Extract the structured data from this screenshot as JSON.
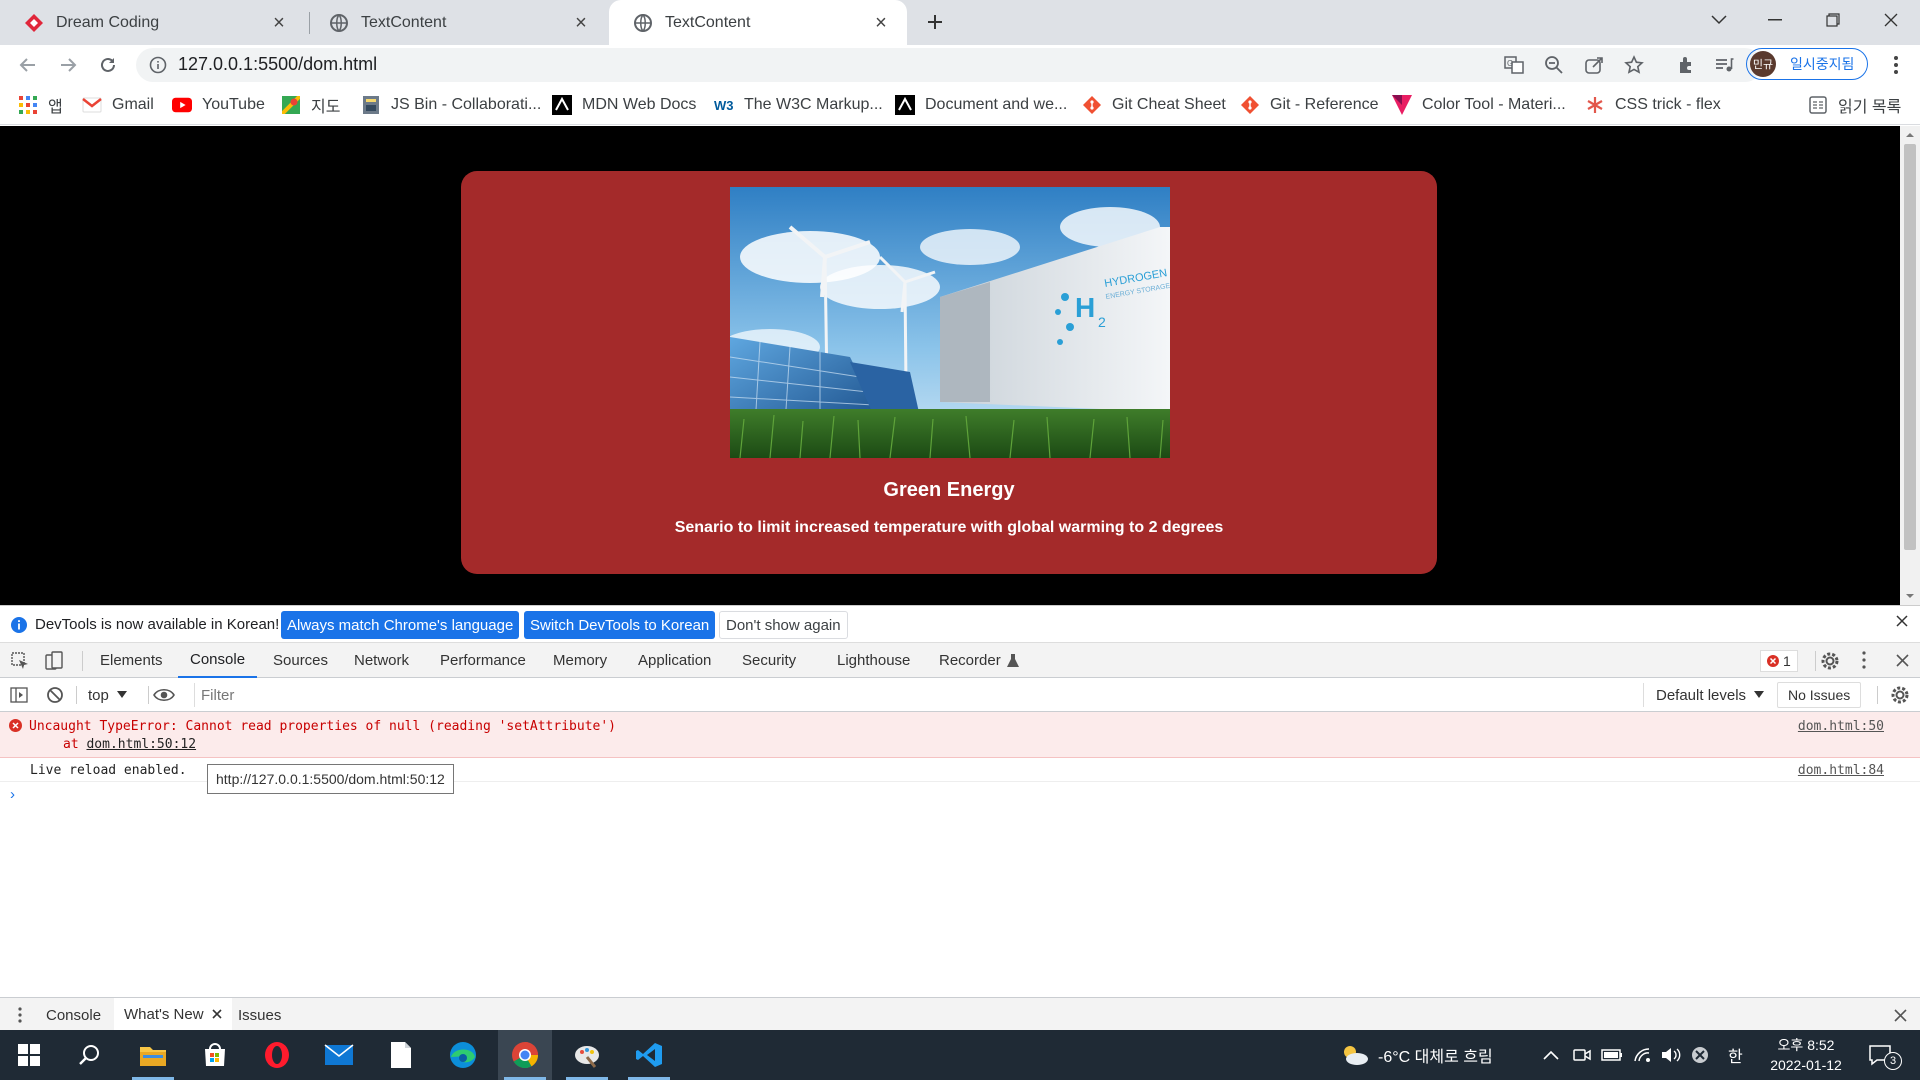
{
  "tabs": [
    {
      "title": "Dream Coding",
      "icon": "dream-coding-logo-icon"
    },
    {
      "title": "TextContent",
      "icon": "globe-icon"
    },
    {
      "title": "TextContent",
      "icon": "globe-icon",
      "active": true
    }
  ],
  "address_bar": {
    "url": "127.0.0.1:5500/dom.html"
  },
  "profile": {
    "avatar_text": "민규",
    "status": "일시중지됨"
  },
  "bookmarks": [
    {
      "label": "앱",
      "icon": "apps-grid-icon"
    },
    {
      "label": "Gmail",
      "icon": "gmail-icon"
    },
    {
      "label": "YouTube",
      "icon": "youtube-icon"
    },
    {
      "label": "지도",
      "icon": "maps-icon"
    },
    {
      "label": "JS Bin - Collaborati...",
      "icon": "jsbin-icon"
    },
    {
      "label": "MDN Web Docs",
      "icon": "mdn-icon"
    },
    {
      "label": "The W3C Markup...",
      "icon": "w3c-icon"
    },
    {
      "label": "Document and we...",
      "icon": "mdn-icon"
    },
    {
      "label": "Git Cheat Sheet",
      "icon": "git-icon"
    },
    {
      "label": "Git - Reference",
      "icon": "git-icon"
    },
    {
      "label": "Color Tool - Materi...",
      "icon": "color-tool-icon"
    },
    {
      "label": "CSS trick - flex",
      "icon": "css-tricks-icon"
    }
  ],
  "reading_list": "읽기 목록",
  "page": {
    "card_title": "Green Energy",
    "card_text": "Senario to limit increased temperature with global warming to 2 degrees",
    "image_lettering": "HYDROGEN ENERGY STORAGE",
    "card_color": "#a42a2a"
  },
  "infobar": {
    "message": "DevTools is now available in Korean!",
    "btn_match": "Always match Chrome's language",
    "btn_switch": "Switch DevTools to Korean",
    "btn_dismiss": "Don't show again"
  },
  "devtools": {
    "tabs": [
      "Elements",
      "Console",
      "Sources",
      "Network",
      "Performance",
      "Memory",
      "Application",
      "Security",
      "Lighthouse",
      "Recorder"
    ],
    "active_tab": "Console",
    "error_count": "1",
    "context": "top",
    "filter_placeholder": "Filter",
    "levels": "Default levels",
    "issues": "No Issues",
    "error": {
      "line1": "Uncaught TypeError: Cannot read properties of null (reading 'setAttribute')",
      "line2_prefix": "at ",
      "line2_link": "dom.html:50:12",
      "source": "dom.html:50"
    },
    "log": {
      "text": "Live reload enabled.",
      "source": "dom.html:84"
    },
    "tooltip": "http://127.0.0.1:5500/dom.html:50:12",
    "prompt": "›",
    "drawer_tabs": [
      "Console",
      "What's New",
      "Issues"
    ]
  },
  "taskbar": {
    "weather": "-6°C 대체로 흐림",
    "ime": "한",
    "time": "오후 8:52",
    "date": "2022-01-12",
    "notifications": "3"
  }
}
